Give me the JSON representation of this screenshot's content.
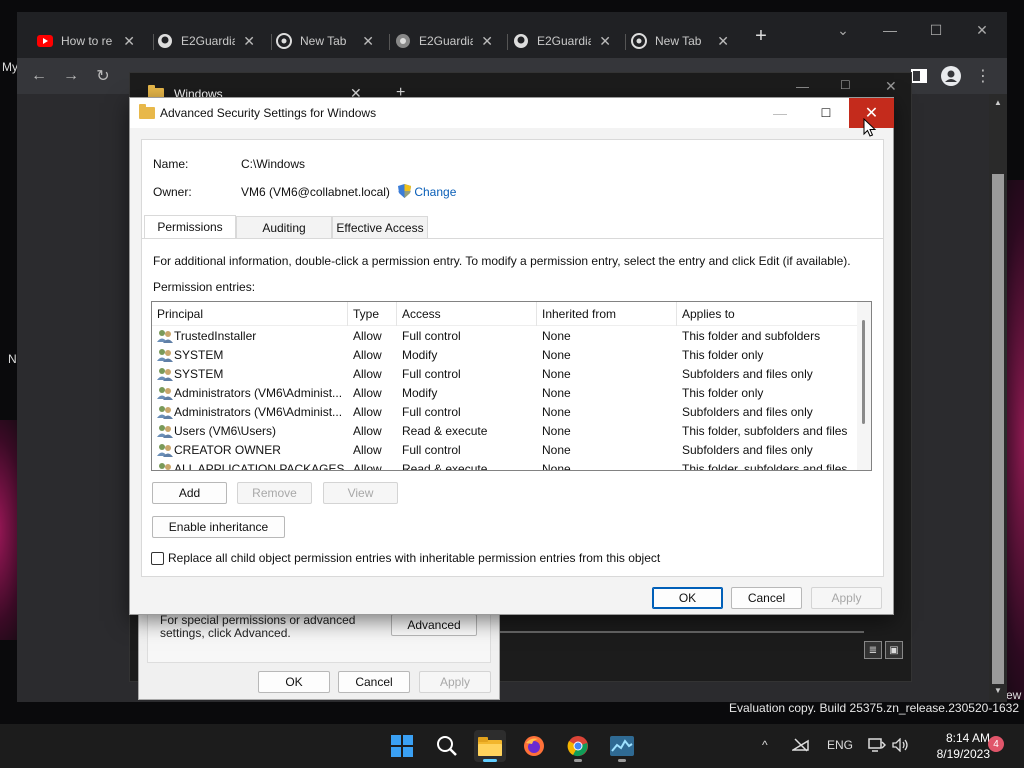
{
  "desktop": {
    "frag_my": "My",
    "frag_n": "N",
    "frag_ew": "ew",
    "watermark": "Evaluation copy. Build 25375.zn_release.230520-1632"
  },
  "browser": {
    "tabs": [
      {
        "title": "How to re",
        "icon": "youtube-icon"
      },
      {
        "title": "E2Guardia",
        "icon": "github-icon"
      },
      {
        "title": "New Tab",
        "icon": "chrome-icon"
      },
      {
        "title": "E2Guardia",
        "icon": "globe-icon"
      },
      {
        "title": "E2Guardia",
        "icon": "github-icon"
      },
      {
        "title": "New Tab",
        "icon": "chrome-icon"
      }
    ],
    "close_glyph": "✕",
    "new_tab_glyph": "+"
  },
  "explorer": {
    "title": "Windows",
    "close_glyph": "✕",
    "add_glyph": "+"
  },
  "properties": {
    "advanced_text": "For special permissions or advanced settings, click Advanced.",
    "advanced_button": "Advanced",
    "ok": "OK",
    "cancel": "Cancel",
    "apply": "Apply"
  },
  "dialog": {
    "title": "Advanced Security Settings for Windows",
    "name_label": "Name:",
    "name_value": "C:\\Windows",
    "owner_label": "Owner:",
    "owner_value": "VM6 (VM6@collabnet.local)",
    "change_link": "Change",
    "tabs": [
      "Permissions",
      "Auditing",
      "Effective Access"
    ],
    "info_text": "For additional information, double-click a permission entry. To modify a permission entry, select the entry and click Edit (if available).",
    "entries_label": "Permission entries:",
    "columns": [
      "Principal",
      "Type",
      "Access",
      "Inherited from",
      "Applies to"
    ],
    "rows": [
      {
        "principal": "TrustedInstaller",
        "type": "Allow",
        "access": "Full control",
        "inherited": "None",
        "applies": "This folder and subfolders"
      },
      {
        "principal": "SYSTEM",
        "type": "Allow",
        "access": "Modify",
        "inherited": "None",
        "applies": "This folder only"
      },
      {
        "principal": "SYSTEM",
        "type": "Allow",
        "access": "Full control",
        "inherited": "None",
        "applies": "Subfolders and files only"
      },
      {
        "principal": "Administrators (VM6\\Administ...",
        "type": "Allow",
        "access": "Modify",
        "inherited": "None",
        "applies": "This folder only"
      },
      {
        "principal": "Administrators (VM6\\Administ...",
        "type": "Allow",
        "access": "Full control",
        "inherited": "None",
        "applies": "Subfolders and files only"
      },
      {
        "principal": "Users (VM6\\Users)",
        "type": "Allow",
        "access": "Read & execute",
        "inherited": "None",
        "applies": "This folder, subfolders and files"
      },
      {
        "principal": "CREATOR OWNER",
        "type": "Allow",
        "access": "Full control",
        "inherited": "None",
        "applies": "Subfolders and files only"
      },
      {
        "principal": "ALL APPLICATION PACKAGES",
        "type": "Allow",
        "access": "Read & execute",
        "inherited": "None",
        "applies": "This folder, subfolders and files"
      }
    ],
    "add": "Add",
    "remove": "Remove",
    "view": "View",
    "enable_inheritance": "Enable inheritance",
    "replace_label": "Replace all child object permission entries with inheritable permission entries from this object",
    "ok": "OK",
    "cancel": "Cancel",
    "apply": "Apply",
    "close_glyph": "✕",
    "min_glyph": "—",
    "max_glyph": "☐"
  },
  "taskbar": {
    "lang": "ENG",
    "time": "8:14 AM",
    "date": "8/19/2023",
    "badge": "4",
    "chevron": "^"
  },
  "colors": {
    "close_red": "#c42b1c",
    "accent_blue": "#005fb8",
    "link_blue": "#0a5fb8"
  }
}
